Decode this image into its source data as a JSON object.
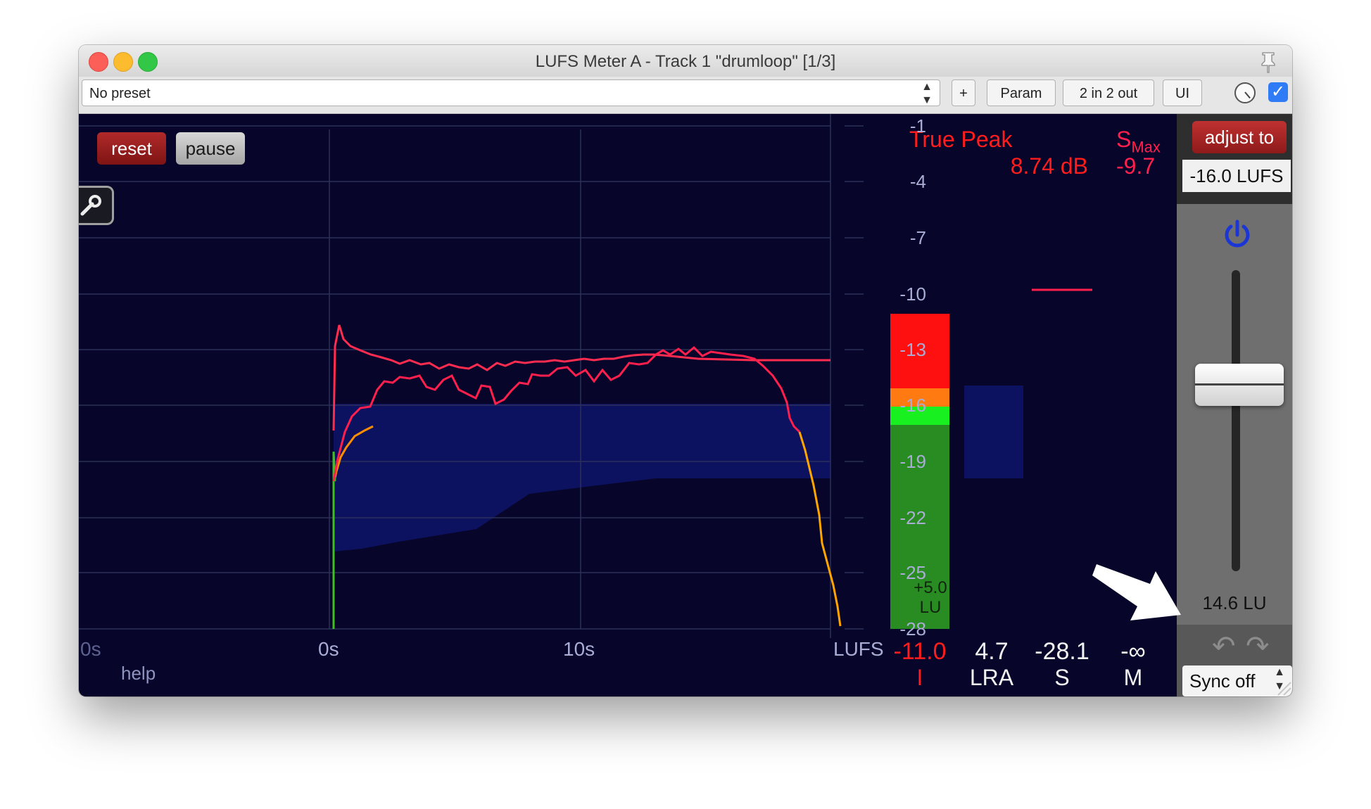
{
  "window": {
    "title": "LUFS Meter A - Track 1 \"drumloop\" [1/3]"
  },
  "toolbar": {
    "preset": "No preset",
    "add_label": "+",
    "param_label": "Param",
    "io_label": "2 in 2 out",
    "ui_label": "UI",
    "checkbox_mark": "✓"
  },
  "meter": {
    "reset_label": "reset",
    "pause_label": "pause",
    "help_label": "help",
    "true_peak_label": "True Peak",
    "true_peak_value": "8.74 dB",
    "smax_label_s": "S",
    "smax_label_sub": "Max",
    "smax_value": "-9.7",
    "y_ticks": [
      "-1",
      "-4",
      "-7",
      "-10",
      "-13",
      "-16",
      "-19",
      "-22",
      "-25",
      "-28"
    ],
    "x_ticks": [
      "0s",
      "0s",
      "10s"
    ],
    "unit_label": "LUFS",
    "bar_label_top": "+5.0",
    "bar_label_bottom": "LU",
    "stats": [
      {
        "value": "-11.0",
        "label": "I"
      },
      {
        "value": "4.7",
        "label": "LRA"
      },
      {
        "value": "-28.1",
        "label": "S"
      },
      {
        "value": "-∞",
        "label": "M"
      }
    ],
    "colors": {
      "background": "#07062a",
      "short_term": "#ff1f4d",
      "integrated": "#ff1c1c",
      "range_fill": "#0c1160",
      "grid": "#2d3158"
    }
  },
  "side": {
    "adjust_label": "adjust to",
    "target_value": "-16.0 LUFS",
    "lu_value": "14.6 LU",
    "undo_icon": "↶",
    "redo_icon": "↷",
    "sync_label": "Sync off"
  }
}
